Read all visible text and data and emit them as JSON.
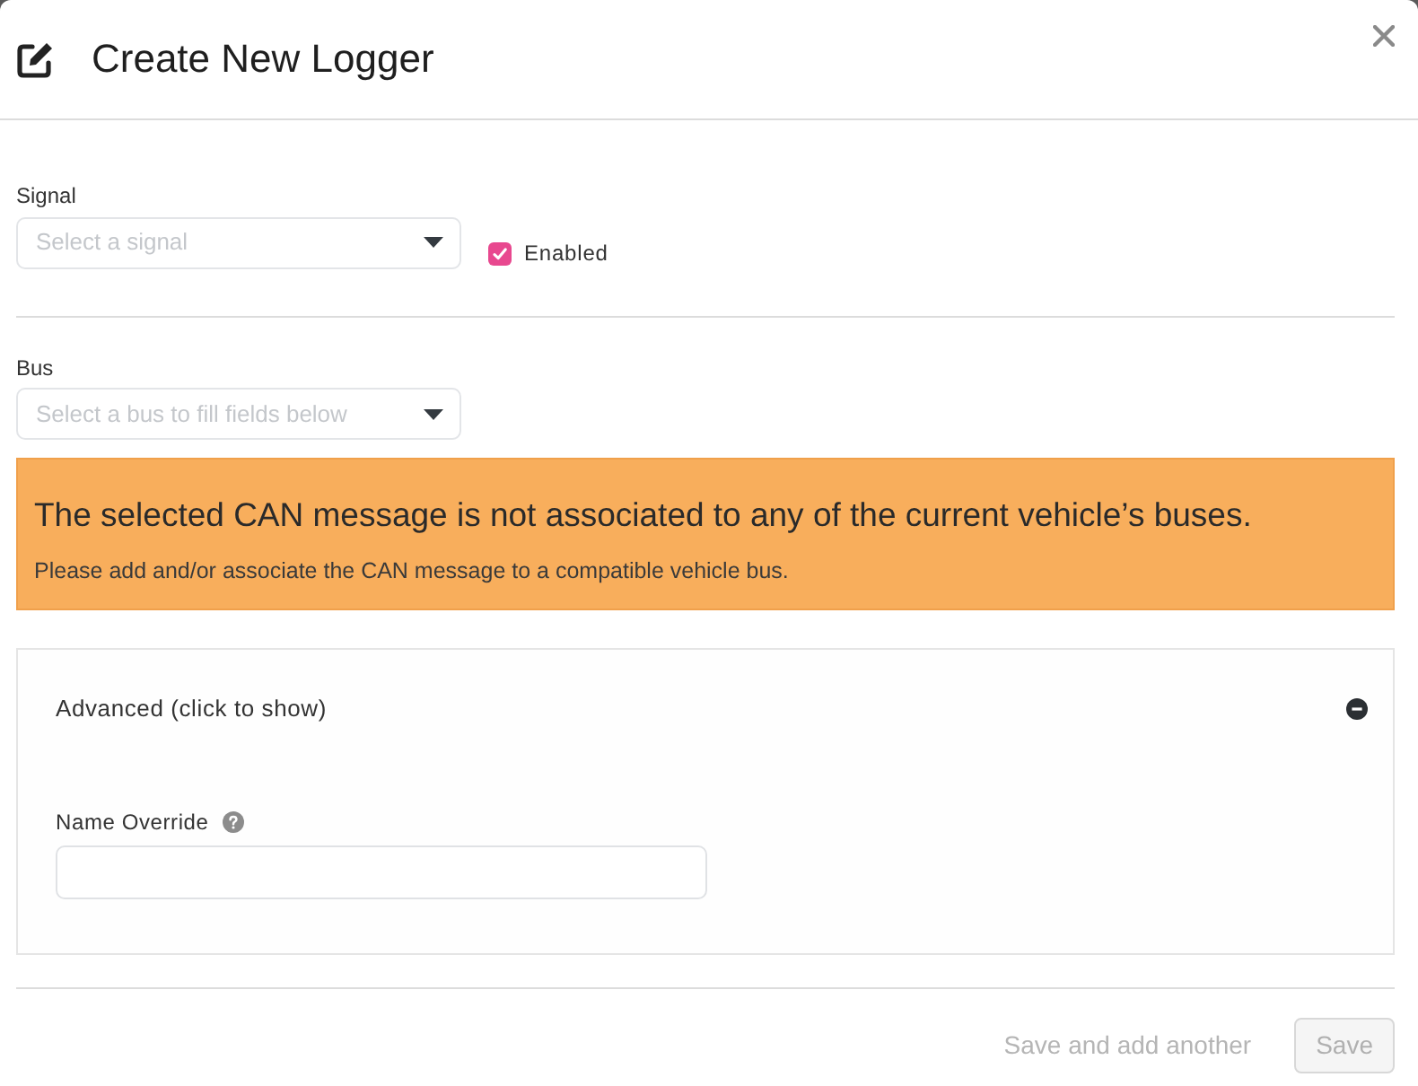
{
  "dialog": {
    "title": "Create New Logger"
  },
  "signal": {
    "label": "Signal",
    "placeholder": "Select a signal"
  },
  "enabled": {
    "label": "Enabled",
    "checked": true
  },
  "bus": {
    "label": "Bus",
    "placeholder": "Select a bus to fill fields below"
  },
  "alert": {
    "heading": "The selected CAN message is not associated to any of the current vehicle’s buses.",
    "message": "Please add and/or associate the CAN message to a compatible vehicle bus."
  },
  "advanced": {
    "label": "Advanced (click to show)",
    "expanded": true,
    "fields": [
      {
        "label": "Name Override"
      }
    ]
  },
  "buttons": [
    {
      "label": "Save and add another",
      "kind": "link",
      "disabled": true
    },
    {
      "label": "Save",
      "kind": "button",
      "disabled": true
    }
  ]
}
